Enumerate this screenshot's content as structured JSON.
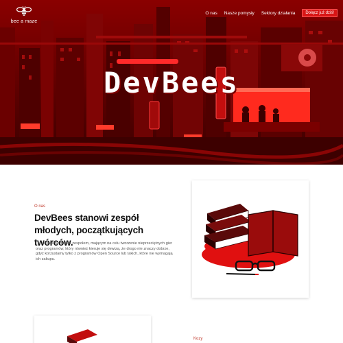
{
  "brand": {
    "name": "bee a maze"
  },
  "nav": {
    "links": [
      "O nas",
      "Nasze pomysły",
      "Sektory działania"
    ],
    "cta": "Dołącz już dziś!"
  },
  "hero": {
    "title": "DevBees"
  },
  "about": {
    "label": "O nas",
    "heading": "DevBees stanowi zespół młodych, początkujących twórców.",
    "text": "Jesteśmy małym zespołem, mającym na celu tworzenie nieprzeciętnych gier oraz programów, który również kieruje się dewizą, że drogo nie znaczy dobrze, gdyż korzystamy tylko z programów Open Source lub takich, które nie wymagają ich zakupu."
  },
  "next_section": {
    "label": "Kozy"
  },
  "colors": {
    "accent": "#d71515",
    "hero_bg": "#5a0000",
    "label": "#c0392b"
  }
}
